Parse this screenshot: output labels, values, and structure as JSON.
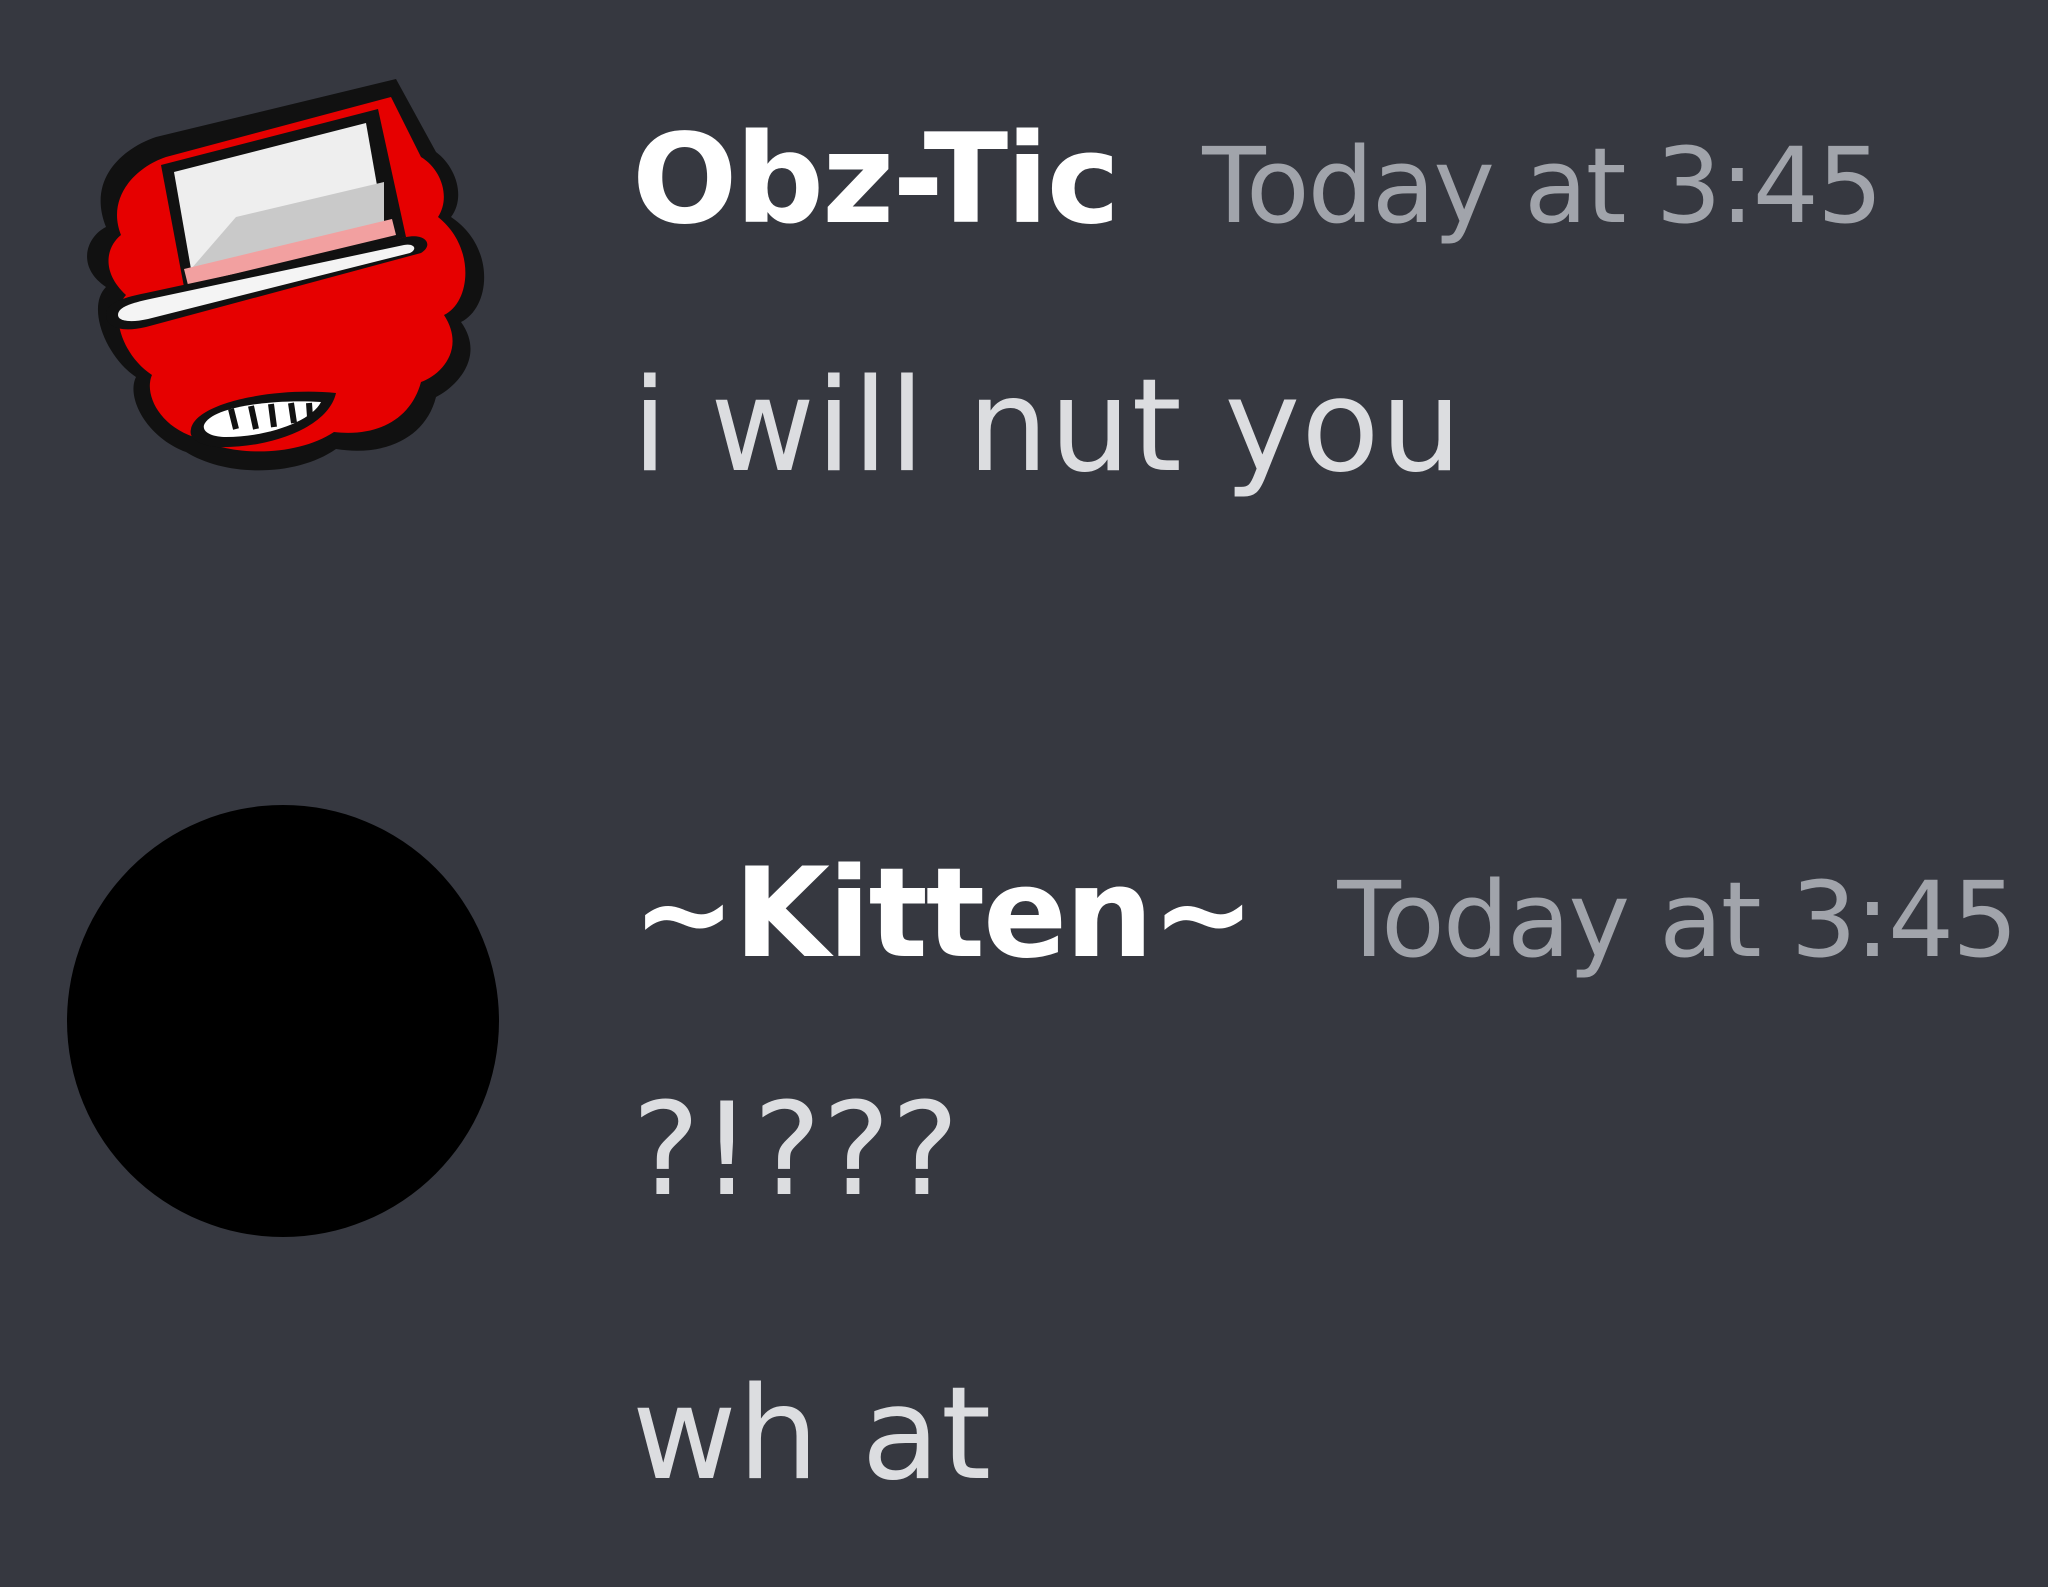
{
  "messages": [
    {
      "author": "Obz-Tic",
      "timestamp": "Today at 3:45",
      "avatar": "red-hat-character-avatar",
      "lines": [
        "i will nut you"
      ]
    },
    {
      "author": "~Kitten~",
      "timestamp": "Today at 3:45",
      "avatar": "black-circle-avatar",
      "lines": [
        "?!???",
        "wh at"
      ]
    }
  ],
  "colors": {
    "background": "#363840",
    "username": "#ffffff",
    "timestamp": "#a1a4ab",
    "message_text": "#dcdde0",
    "avatar_red": "#e60000",
    "avatar_black": "#000000"
  }
}
